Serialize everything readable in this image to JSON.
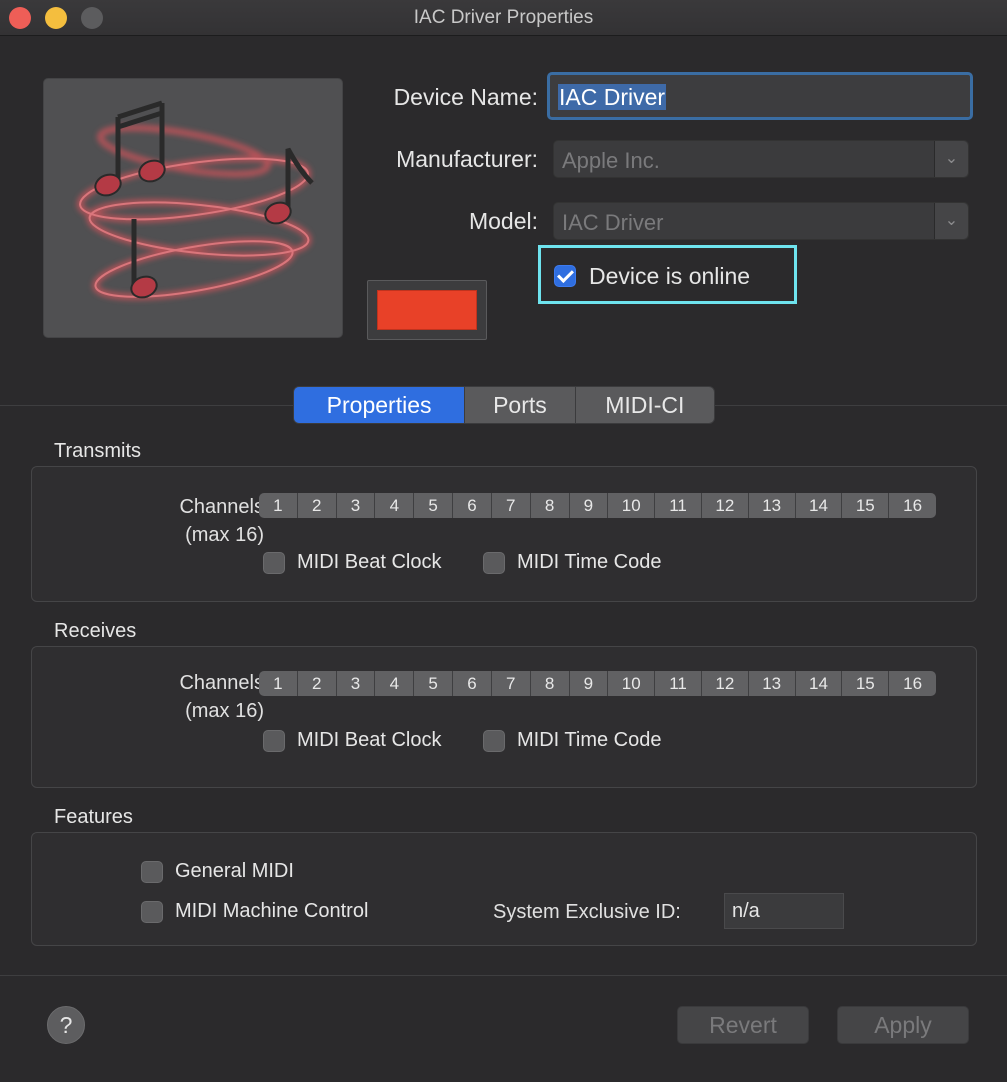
{
  "window": {
    "title": "IAC Driver Properties"
  },
  "device": {
    "name_label": "Device Name:",
    "name_value": "IAC Driver",
    "manufacturer_label": "Manufacturer:",
    "manufacturer_value": "Apple Inc.",
    "model_label": "Model:",
    "model_value": "IAC Driver",
    "online_label": "Device is online",
    "online_checked": true,
    "color": "#e84128"
  },
  "tabs": [
    {
      "label": "Properties",
      "active": true
    },
    {
      "label": "Ports",
      "active": false
    },
    {
      "label": "MIDI-CI",
      "active": false
    }
  ],
  "transmits": {
    "title": "Transmits",
    "channels_label_line1": "Channels",
    "channels_label_line2": "(max 16)",
    "channels": [
      "1",
      "2",
      "3",
      "4",
      "5",
      "6",
      "7",
      "8",
      "9",
      "10",
      "11",
      "12",
      "13",
      "14",
      "15",
      "16"
    ],
    "beat_clock_label": "MIDI Beat Clock",
    "time_code_label": "MIDI Time Code"
  },
  "receives": {
    "title": "Receives",
    "channels_label_line1": "Channels",
    "channels_label_line2": "(max 16)",
    "channels": [
      "1",
      "2",
      "3",
      "4",
      "5",
      "6",
      "7",
      "8",
      "9",
      "10",
      "11",
      "12",
      "13",
      "14",
      "15",
      "16"
    ],
    "beat_clock_label": "MIDI Beat Clock",
    "time_code_label": "MIDI Time Code"
  },
  "features": {
    "title": "Features",
    "general_midi_label": "General MIDI",
    "machine_control_label": "MIDI Machine Control",
    "sysex_label": "System Exclusive ID:",
    "sysex_value": "n/a"
  },
  "footer": {
    "help_label": "?",
    "revert_label": "Revert",
    "apply_label": "Apply"
  },
  "icons": {
    "close": "close-button-icon",
    "minimize": "minimize-button-icon",
    "zoom": "zoom-button-icon",
    "device": "midi-music-notes-icon",
    "popup_arrow": "chevron-down-icon"
  }
}
